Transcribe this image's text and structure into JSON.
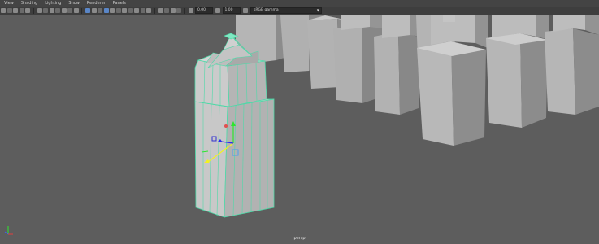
{
  "menubar": {
    "items": [
      {
        "label": "View"
      },
      {
        "label": "Shading"
      },
      {
        "label": "Lighting"
      },
      {
        "label": "Show"
      },
      {
        "label": "Renderer"
      },
      {
        "label": "Panels"
      }
    ]
  },
  "toolbar": {
    "exposure_value": "0.00",
    "gamma_value": "1.00",
    "color_space": "sRGB gamma",
    "icon_names": [
      "select-camera-icon",
      "lock-camera-icon",
      "camera-attributes-icon",
      "bookmarks-icon",
      "image-plane-icon",
      "grid-icon",
      "film-gate-icon",
      "resolution-gate-icon",
      "gate-mask-icon",
      "field-chart-icon",
      "safe-action-icon",
      "safe-title-icon",
      "wireframe-icon",
      "smooth-shade-icon",
      "use-default-material-icon",
      "wireframe-on-shaded-icon",
      "textured-icon",
      "lighting-icon",
      "shadows-icon",
      "screen-space-ao-icon",
      "motion-blur-icon",
      "multisample-aa-icon",
      "depth-of-field-icon",
      "isolate-select-icon",
      "xray-icon",
      "xray-joints-icon",
      "backface-culling-icon",
      "exposure-icon",
      "gamma-icon",
      "color-management-icon"
    ]
  },
  "viewport": {
    "camera_label": "persp",
    "wire_color": "#4fd9a8",
    "background_color": "#5d5d5d",
    "axis_labels": {
      "x": "X",
      "y": "Y",
      "z": "Z"
    }
  }
}
